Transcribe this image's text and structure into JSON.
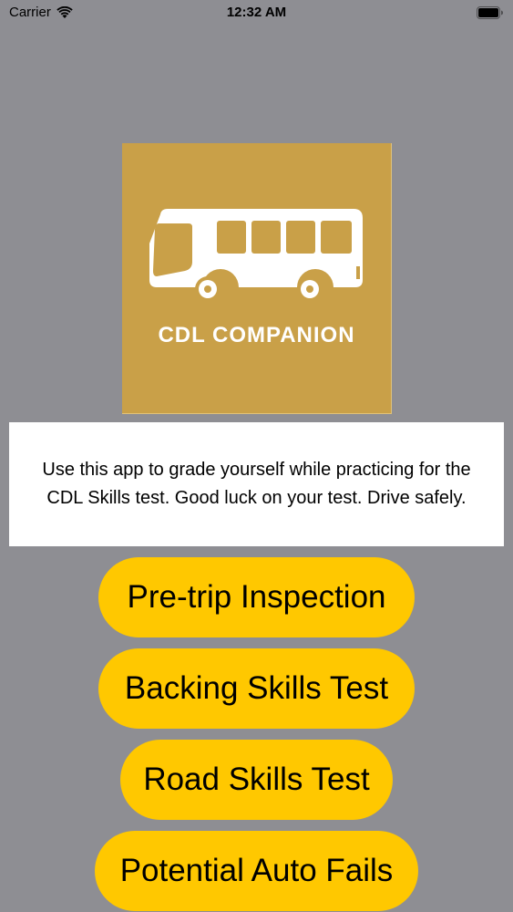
{
  "status_bar": {
    "carrier": "Carrier",
    "time": "12:32 AM",
    "wifi_icon": "wifi-icon",
    "battery_icon": "battery-icon"
  },
  "logo": {
    "text": "CDL COMPANION",
    "icon": "bus-icon",
    "background": "#c9a048"
  },
  "info": {
    "text": "Use this app to grade yourself while practicing for the CDL Skills test. Good luck on your test. Drive safely."
  },
  "buttons": [
    {
      "label": "Pre-trip Inspection"
    },
    {
      "label": "Backing Skills Test"
    },
    {
      "label": "Road Skills Test"
    },
    {
      "label": "Potential Auto Fails"
    }
  ],
  "colors": {
    "background": "#8e8e93",
    "button": "#ffc800",
    "info_box": "#ffffff"
  }
}
